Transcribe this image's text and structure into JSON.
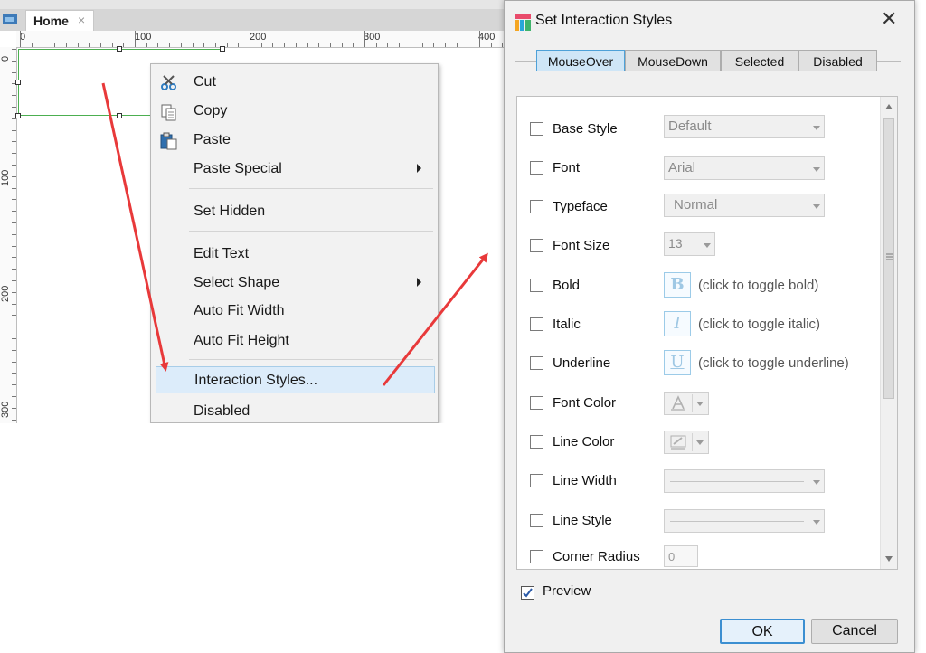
{
  "editor": {
    "tab_label": "Home",
    "tab_close": "×",
    "ruler_h": [
      "0",
      "100",
      "200",
      "300",
      "400"
    ],
    "ruler_v": [
      "0",
      "100",
      "200",
      "300"
    ]
  },
  "context_menu": {
    "items": [
      {
        "label": "Cut",
        "icon": "scissors-icon"
      },
      {
        "label": "Copy",
        "icon": "copy-icon"
      },
      {
        "label": "Paste",
        "icon": "paste-icon"
      },
      {
        "label": "Paste Special",
        "submenu": true
      },
      {
        "label": "Set Hidden"
      },
      {
        "label": "Edit Text"
      },
      {
        "label": "Select Shape",
        "submenu": true
      },
      {
        "label": "Auto Fit Width"
      },
      {
        "label": "Auto Fit Height"
      },
      {
        "label": "Interaction Styles...",
        "highlighted": true
      },
      {
        "label": "Disabled"
      }
    ]
  },
  "dialog": {
    "title": "Set Interaction Styles",
    "close_glyph": "✕",
    "tabs": [
      "MouseOver",
      "MouseDown",
      "Selected",
      "Disabled"
    ],
    "active_tab": "MouseOver",
    "rows": [
      {
        "label": "Base Style",
        "value": "Default"
      },
      {
        "label": "Font",
        "value": "Arial"
      },
      {
        "label": "Typeface",
        "value": "Normal"
      },
      {
        "label": "Font Size",
        "value": "13"
      },
      {
        "label": "Bold",
        "glyph": "B",
        "hint": "(click to toggle bold)"
      },
      {
        "label": "Italic",
        "glyph": "I",
        "hint": "(click to toggle italic)"
      },
      {
        "label": "Underline",
        "glyph": "U",
        "hint": "(click to toggle underline)"
      },
      {
        "label": "Font Color"
      },
      {
        "label": "Line Color"
      },
      {
        "label": "Line Width"
      },
      {
        "label": "Line Style"
      },
      {
        "label": "Corner Radius",
        "value": "0"
      }
    ],
    "preview_label": "Preview",
    "preview_checked": true,
    "ok_label": "OK",
    "cancel_label": "Cancel"
  },
  "colors": {
    "accent": "#3c8fd1",
    "arrow": "#e8393a",
    "selection": "#4caf50"
  }
}
